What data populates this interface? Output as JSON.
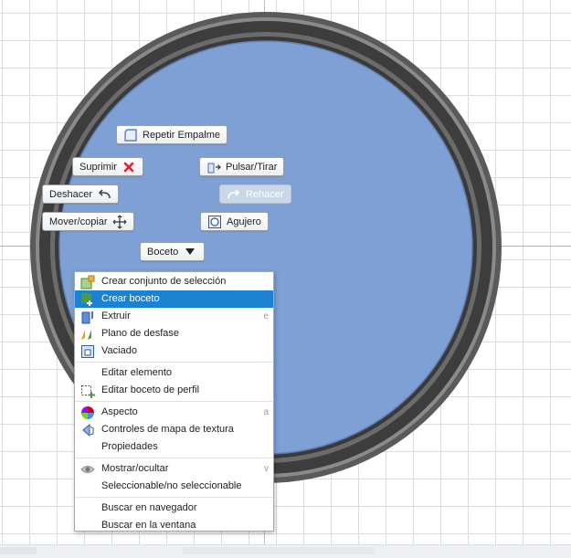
{
  "marking_menu": {
    "repeat_fillet": "Repetir Empalme",
    "delete": "Suprimir",
    "press_pull": "Pulsar/Tirar",
    "undo": "Deshacer",
    "redo": "Rehacer",
    "move_copy": "Mover/copiar",
    "hole": "Agujero",
    "sketch": "Boceto"
  },
  "context_menu": {
    "groups": [
      [
        {
          "label": "Crear conjunto de selección",
          "icon": "selection-set-icon",
          "shortcut": ""
        },
        {
          "label": "Crear boceto",
          "icon": "create-sketch-icon",
          "shortcut": "",
          "highlighted": true
        },
        {
          "label": "Extruir",
          "icon": "extrude-icon",
          "shortcut": "e"
        },
        {
          "label": "Plano de desfase",
          "icon": "offset-plane-icon",
          "shortcut": ""
        },
        {
          "label": "Vaciado",
          "icon": "shell-icon",
          "shortcut": ""
        }
      ],
      [
        {
          "label": "Editar elemento",
          "icon": "",
          "shortcut": ""
        },
        {
          "label": "Editar boceto de perfil",
          "icon": "edit-profile-sketch-icon",
          "shortcut": ""
        }
      ],
      [
        {
          "label": "Aspecto",
          "icon": "appearance-icon",
          "shortcut": "a"
        },
        {
          "label": "Controles de mapa de textura",
          "icon": "texture-map-icon",
          "shortcut": ""
        },
        {
          "label": "Propiedades",
          "icon": "",
          "shortcut": ""
        }
      ],
      [
        {
          "label": "Mostrar/ocultar",
          "icon": "eye-icon",
          "shortcut": "v"
        },
        {
          "label": "Seleccionable/no seleccionable",
          "icon": "",
          "shortcut": ""
        }
      ],
      [
        {
          "label": "Buscar en navegador",
          "icon": "",
          "shortcut": ""
        },
        {
          "label": "Buscar en la ventana",
          "icon": "",
          "shortcut": ""
        }
      ]
    ]
  },
  "colors": {
    "face_fill": "#7ea0d4",
    "ring_dark": "#4a4a4a",
    "highlight": "#1a82d0",
    "delete_red": "#e0242b"
  }
}
